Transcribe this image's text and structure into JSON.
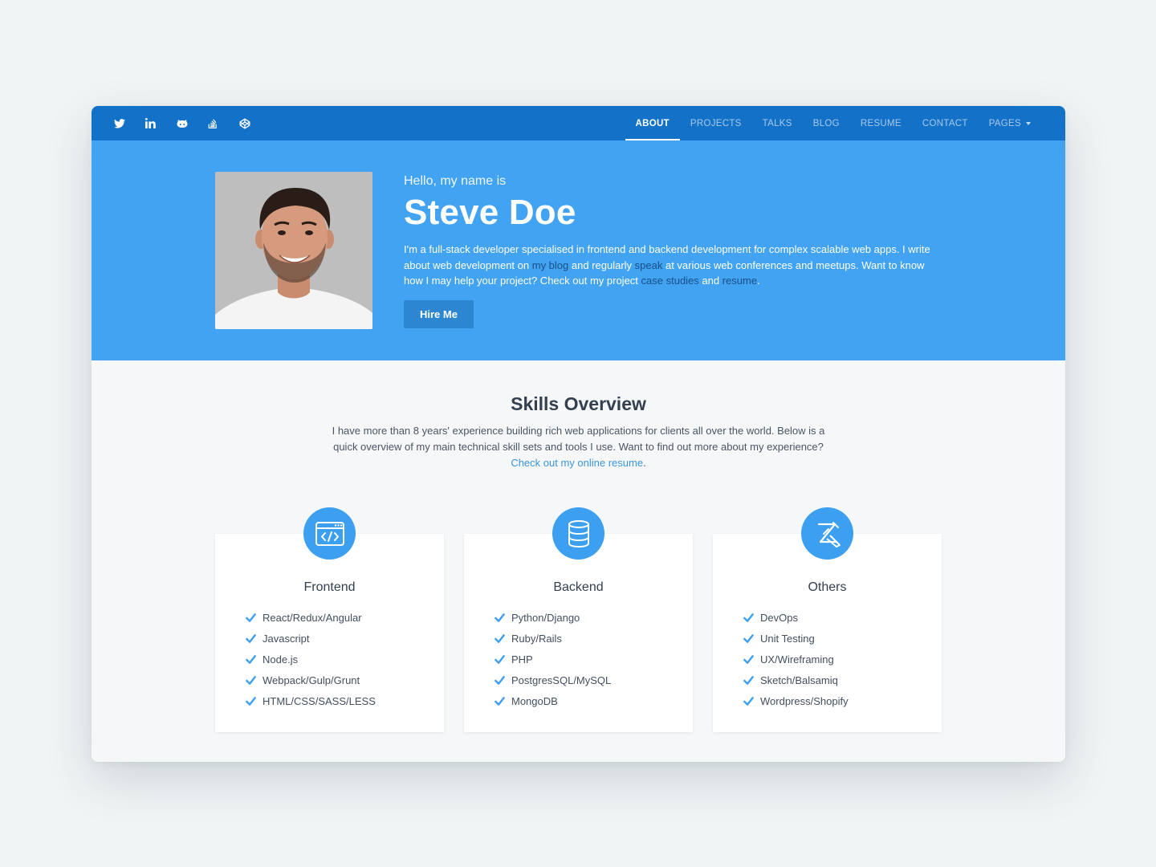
{
  "socials": [
    {
      "icon": "twitter-icon"
    },
    {
      "icon": "linkedin-icon"
    },
    {
      "icon": "github-icon"
    },
    {
      "icon": "stackoverflow-icon"
    },
    {
      "icon": "codepen-icon"
    }
  ],
  "menu": {
    "items": [
      "About",
      "Projects",
      "Talks",
      "Blog",
      "Resume",
      "Contact",
      "Pages"
    ],
    "active": "About"
  },
  "hero": {
    "greeting": "Hello, my name is",
    "name": "Steve Doe",
    "bio": {
      "t1": "I'm a full-stack developer specialised in frontend and backend development for complex scalable web apps. I write about web development on ",
      "link_blog": "my blog",
      "t2": " and regularly ",
      "link_speak": "speak",
      "t3": " at various web conferences and meetups. Want to know how I may help your project? Check out my project ",
      "link_cases": "case studies",
      "t4": " and ",
      "link_resume": "resume",
      "t5": "."
    },
    "cta_label": "Hire Me"
  },
  "skills": {
    "title": "Skills Overview",
    "intro": "I have more than 8 years' experience building rich web applications for clients all over the world. Below is a quick overview of my main technical skill sets and tools I use. Want to find out more about my experience?",
    "intro_link": "Check out my online resume",
    "intro_end": ".",
    "cards": [
      {
        "title": "Frontend",
        "icon": "code-window-icon",
        "items": [
          "React/Redux/Angular",
          "Javascript",
          "Node.js",
          "Webpack/Gulp/Grunt",
          "HTML/CSS/SASS/LESS"
        ]
      },
      {
        "title": "Backend",
        "icon": "database-icon",
        "items": [
          "Python/Django",
          "Ruby/Rails",
          "PHP",
          "PostgresSQL/MySQL",
          "MongoDB"
        ]
      },
      {
        "title": "Others",
        "icon": "toolkit-icon",
        "items": [
          "DevOps",
          "Unit Testing",
          "UX/Wireframing",
          "Sketch/Balsamiq",
          "Wordpress/Shopify"
        ]
      }
    ]
  },
  "colors": {
    "nav": "#1471c8",
    "hero": "#41a3f2",
    "accent": "#3c9ff0",
    "link": "#3b95dd"
  }
}
